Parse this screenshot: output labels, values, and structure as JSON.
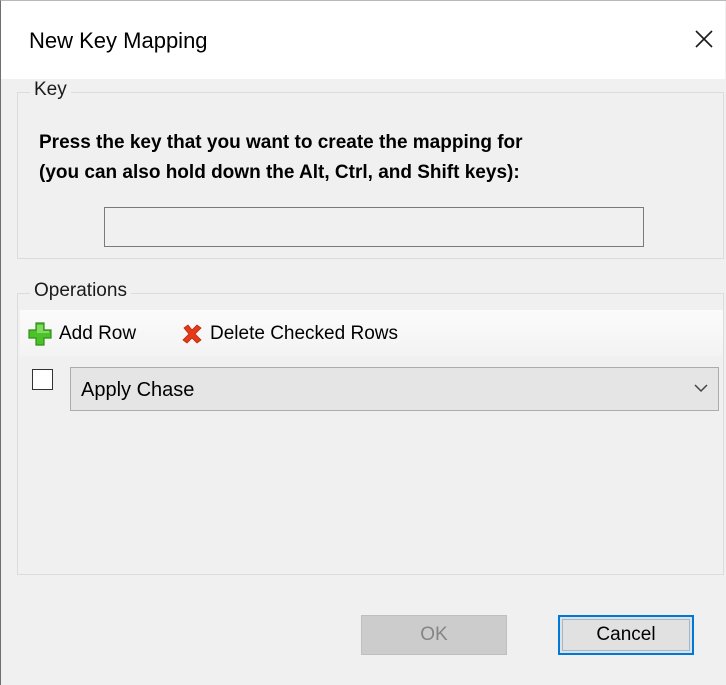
{
  "window": {
    "title": "New Key Mapping",
    "close_icon": "close-x-icon"
  },
  "key_group": {
    "label": "Key",
    "prompt": "Press the key that you want to create the mapping for\n(you can also hold down the Alt, Ctrl, and Shift keys):",
    "key_value": ""
  },
  "operations_group": {
    "label": "Operations",
    "toolbar": {
      "add_row_label": "Add Row",
      "add_row_icon": "plus-icon",
      "delete_label": "Delete Checked Rows",
      "delete_icon": "red-x-icon"
    },
    "rows": [
      {
        "checked": false,
        "operation": "Apply Chase"
      }
    ]
  },
  "buttons": {
    "ok_label": "OK",
    "ok_enabled": false,
    "cancel_label": "Cancel"
  },
  "colors": {
    "accent": "#0078d7",
    "add_icon": "#3fb51c",
    "delete_icon": "#e23c12"
  }
}
